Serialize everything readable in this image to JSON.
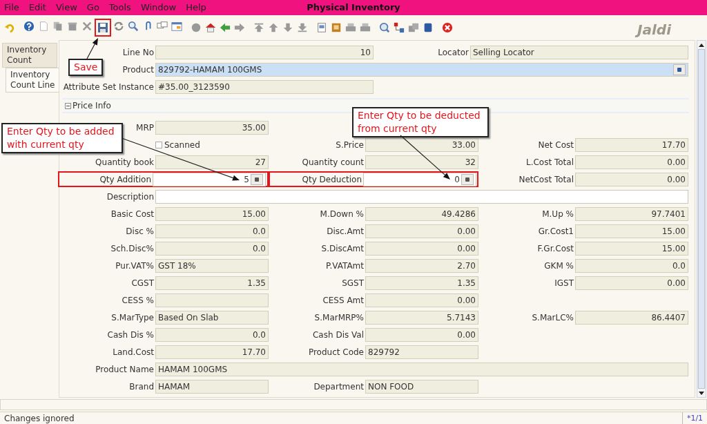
{
  "menu": [
    "File",
    "Edit",
    "View",
    "Go",
    "Tools",
    "Window",
    "Help"
  ],
  "window": {
    "title": "Physical Inventory"
  },
  "logo_text": "Jaldi",
  "toolbar": {
    "save_highlighted": true
  },
  "tabs": [
    {
      "label": "Inventory Count",
      "selected": false
    },
    {
      "label": "Inventory Count Line",
      "selected": true
    }
  ],
  "header_rows": [
    [
      {
        "label": "Line No",
        "value": "10",
        "kind": "number",
        "editable": false,
        "mandatory": false
      },
      {
        "label": "Locator",
        "value": "Selling Locator",
        "kind": "text",
        "editable": false,
        "mandatory": false
      }
    ],
    [
      {
        "label": "Product",
        "value": "829792-HAMAM 100GMS",
        "kind": "lookup",
        "mandatory": true
      }
    ],
    [
      {
        "label": "Attribute Set Instance",
        "value": "#35.00_3123590",
        "kind": "text",
        "editable": false,
        "mandatory": false
      }
    ]
  ],
  "section": {
    "title": "Price Info",
    "expanded": true
  },
  "price_rows": [
    [
      {
        "label": "MRP",
        "value": "35.00",
        "kind": "number",
        "editable": false,
        "highlighted": false
      },
      null,
      null
    ],
    [
      {
        "label": "Scanned",
        "kind": "checkbox",
        "checked": false
      },
      {
        "label": "S.Price",
        "value": "33.00",
        "kind": "number",
        "editable": false,
        "highlighted": false
      },
      {
        "label": "Net Cost",
        "value": "17.70",
        "kind": "number",
        "editable": false,
        "highlighted": false
      }
    ],
    [
      {
        "label": "Quantity book",
        "value": "27",
        "kind": "number",
        "editable": false,
        "highlighted": false
      },
      {
        "label": "Quantity count",
        "value": "32",
        "kind": "number",
        "editable": false,
        "highlighted": false
      },
      {
        "label": "L.Cost Total",
        "value": "0.00",
        "kind": "number",
        "editable": false,
        "highlighted": false
      }
    ],
    [
      {
        "label": "Qty Addition",
        "value": "5",
        "kind": "calc",
        "editable": true,
        "highlighted": true
      },
      {
        "label": "Qty Deduction",
        "value": "0",
        "kind": "calc",
        "editable": true,
        "highlighted": true
      },
      {
        "label": "NetCost Total",
        "value": "0.00",
        "kind": "number",
        "editable": false,
        "highlighted": false
      }
    ],
    [
      {
        "label": "Description",
        "kind": "wide",
        "editable": true,
        "highlighted": false
      }
    ],
    [
      {
        "label": "Basic Cost",
        "value": "15.00",
        "kind": "number",
        "editable": false,
        "highlighted": false
      },
      {
        "label": "M.Down %",
        "value": "49.4286",
        "kind": "number",
        "editable": false,
        "highlighted": false
      },
      {
        "label": "M.Up %",
        "value": "97.7401",
        "kind": "number",
        "editable": false,
        "highlighted": false
      }
    ],
    [
      {
        "label": "Disc %",
        "value": "0.0",
        "kind": "number",
        "editable": false,
        "highlighted": false
      },
      {
        "label": "Disc.Amt",
        "value": "0.00",
        "kind": "number",
        "editable": false,
        "highlighted": false
      },
      {
        "label": "Gr.Cost1",
        "value": "15.00",
        "kind": "number",
        "editable": false,
        "highlighted": false
      }
    ],
    [
      {
        "label": "Sch.Disc%",
        "value": "0.0",
        "kind": "number",
        "editable": false,
        "highlighted": false
      },
      {
        "label": "S.DiscAmt",
        "value": "0.00",
        "kind": "number",
        "editable": false,
        "highlighted": false
      },
      {
        "label": "F.Gr.Cost",
        "value": "15.00",
        "kind": "number",
        "editable": false,
        "highlighted": false
      }
    ],
    [
      {
        "label": "Pur.VAT%",
        "value": "GST 18%",
        "kind": "text",
        "editable": false,
        "highlighted": false
      },
      {
        "label": "P.VATAmt",
        "value": "2.70",
        "kind": "number",
        "editable": false,
        "highlighted": false
      },
      {
        "label": "GKM %",
        "value": "0.0",
        "kind": "number",
        "editable": false,
        "highlighted": false
      }
    ],
    [
      {
        "label": "CGST",
        "value": "1.35",
        "kind": "number",
        "editable": false,
        "highlighted": false
      },
      {
        "label": "SGST",
        "value": "1.35",
        "kind": "number",
        "editable": false,
        "highlighted": false
      },
      {
        "label": "IGST",
        "value": "0.00",
        "kind": "number",
        "editable": false,
        "highlighted": false
      }
    ],
    [
      {
        "label": "CESS %",
        "kind": "number",
        "editable": false,
        "highlighted": false
      },
      {
        "label": "CESS Amt",
        "value": "0.00",
        "kind": "number",
        "editable": false,
        "highlighted": false
      },
      null
    ],
    [
      {
        "label": "S.MarType",
        "value": "Based On Slab",
        "kind": "text",
        "editable": false,
        "highlighted": false
      },
      {
        "label": "S.MarMRP%",
        "value": "5.7143",
        "kind": "number",
        "editable": false,
        "highlighted": false
      },
      {
        "label": "S.MarLC%",
        "value": "86.4407",
        "kind": "number",
        "editable": false,
        "highlighted": false
      }
    ],
    [
      {
        "label": "Cash Dis %",
        "value": "0.0",
        "kind": "number",
        "editable": false,
        "highlighted": false
      },
      {
        "label": "Cash Dis Val",
        "value": "0.00",
        "kind": "number",
        "editable": false,
        "highlighted": false
      },
      null
    ],
    [
      {
        "label": "Land.Cost",
        "value": "17.70",
        "kind": "number",
        "editable": false,
        "highlighted": false
      },
      {
        "label": "Product Code",
        "value": "829792",
        "kind": "text",
        "editable": false,
        "highlighted": false
      },
      null
    ],
    [
      {
        "label": "Product Name",
        "value": "HAMAM 100GMS",
        "kind": "wide",
        "editable": false,
        "highlighted": false
      }
    ],
    [
      {
        "label": "Brand",
        "value": "HAMAM",
        "kind": "text",
        "editable": false,
        "highlighted": false
      },
      {
        "label": "Department",
        "value": "NON FOOD",
        "kind": "text",
        "editable": false,
        "highlighted": false
      },
      null
    ]
  ],
  "annotations": [
    {
      "text": "Save"
    },
    {
      "text": "Enter Qty to be added with current qty"
    },
    {
      "text": "Enter Qty to be deducted from current qty"
    }
  ],
  "status_bar": {
    "message": "Changes ignored",
    "record": "*1/1"
  }
}
